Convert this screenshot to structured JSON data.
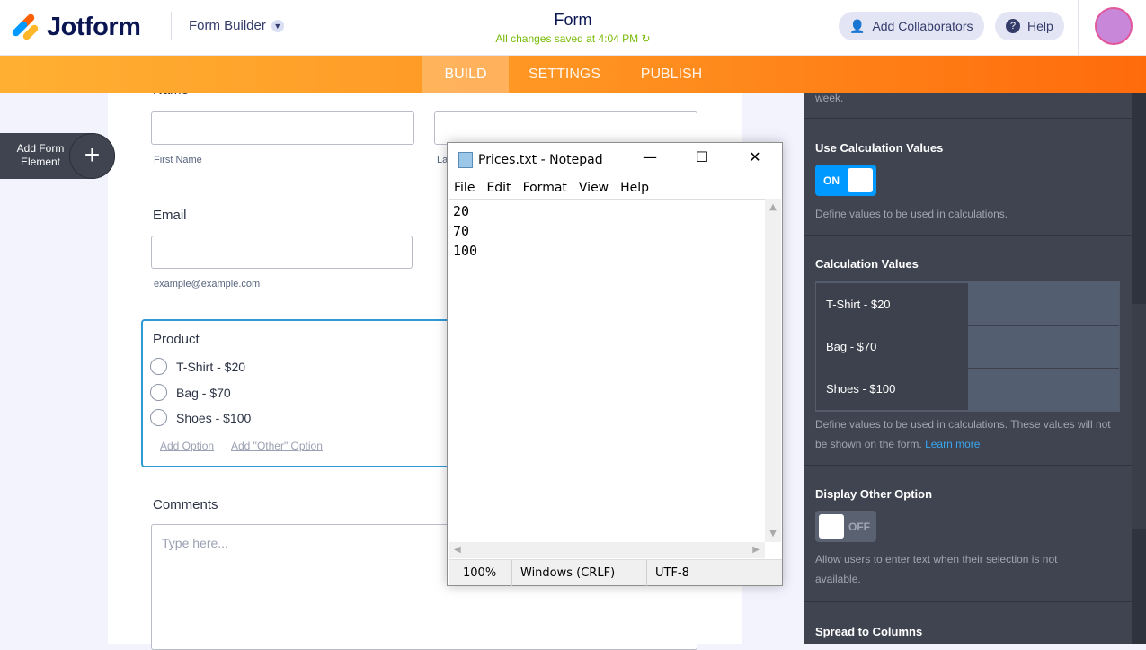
{
  "header": {
    "brand": "Jotform",
    "app_menu": "Form Builder",
    "form_title": "Form",
    "saved_status": "All changes saved at 4:04 PM",
    "add_collaborators": "Add Collaborators",
    "help": "Help"
  },
  "nav": {
    "tabs": [
      "BUILD",
      "SETTINGS",
      "PUBLISH"
    ],
    "active": "BUILD"
  },
  "sidebar": {
    "add_element": "Add Form Element"
  },
  "form": {
    "name_label": "Name",
    "first_name": "First Name",
    "last_name_partial": "La",
    "email_label": "Email",
    "email_sub": "example@example.com",
    "product_label": "Product",
    "options": [
      "T-Shirt - $20",
      "Bag - $70",
      "Shoes - $100"
    ],
    "add_option": "Add Option",
    "add_other_option": "Add \"Other\" Option",
    "comments_label": "Comments",
    "comments_placeholder": "Type here..."
  },
  "panel": {
    "top_text": "week.",
    "use_calc_title": "Use Calculation Values",
    "use_calc_toggle": "ON",
    "use_calc_desc": "Define values to be used in calculations.",
    "calc_values_title": "Calculation Values",
    "calc_rows": [
      "T-Shirt - $20",
      "Bag - $70",
      "Shoes - $100"
    ],
    "calc_desc": "Define values to be used in calculations. These values will not be shown on the form.",
    "learn_more": "Learn more",
    "other_title": "Display Other Option",
    "other_toggle": "OFF",
    "other_desc": "Allow users to enter text when their selection is not available.",
    "spread_title": "Spread to Columns"
  },
  "notepad": {
    "title": "Prices.txt - Notepad",
    "menu": [
      "File",
      "Edit",
      "Format",
      "View",
      "Help"
    ],
    "content": "20\n70\n100",
    "zoom": "100%",
    "line_endings": "Windows (CRLF)",
    "encoding": "UTF-8"
  },
  "colors": {
    "accent": "#ff6100",
    "toggle_on": "#0099ff",
    "panel": "#3f4450"
  }
}
